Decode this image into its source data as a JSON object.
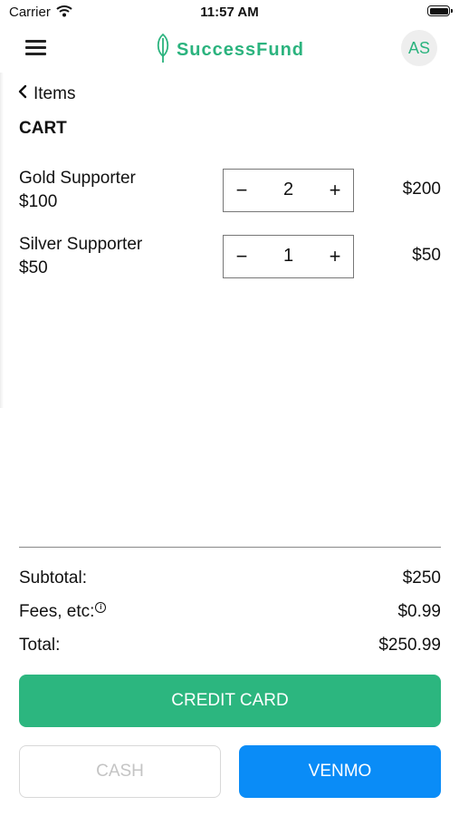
{
  "status_bar": {
    "carrier": "Carrier",
    "time": "11:57 AM",
    "icons": [
      "wifi-icon",
      "battery-icon"
    ]
  },
  "header": {
    "menu_icon": "hamburger-menu-icon",
    "brand": "SuccessFund",
    "logo_icon": "leaf-icon",
    "avatar_initials": "AS",
    "brand_color": "#2bb37e"
  },
  "nav": {
    "back_label": "Items",
    "back_icon": "chevron-left-icon"
  },
  "cart": {
    "title": "CART",
    "items": [
      {
        "name": "Gold Supporter",
        "price": "$100",
        "quantity": "2",
        "total": "$200",
        "minus": "−",
        "plus": "+"
      },
      {
        "name": "Silver Supporter",
        "price": "$50",
        "quantity": "1",
        "total": "$50",
        "minus": "−",
        "plus": "+"
      }
    ]
  },
  "summary": {
    "subtotal_label": "Subtotal:",
    "subtotal_value": "$250",
    "fees_label": "Fees, etc:",
    "fees_info_icon": "info-icon",
    "fees_value": "$0.99",
    "total_label": "Total:",
    "total_value": "$250.99"
  },
  "payment": {
    "credit_card_label": "CREDIT CARD",
    "cash_label": "CASH",
    "venmo_label": "VENMO",
    "credit_color": "#2cb67f",
    "venmo_color": "#0a8cf7"
  }
}
